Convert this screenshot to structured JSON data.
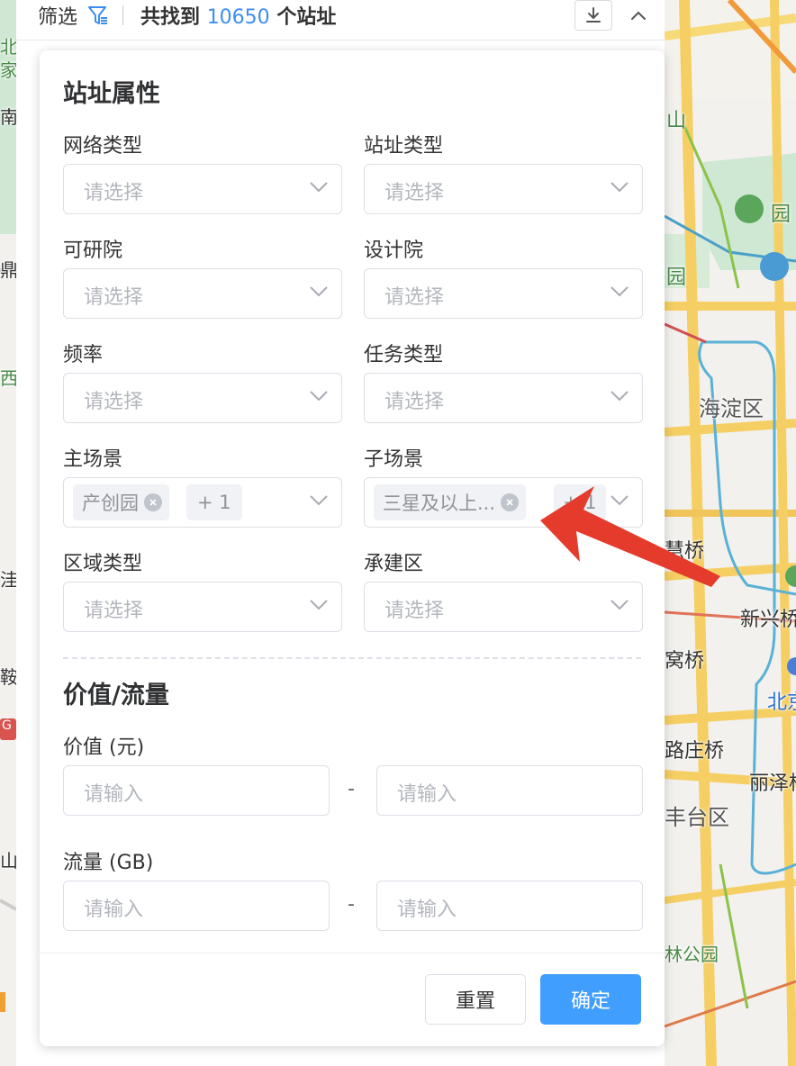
{
  "topbar": {
    "filter_label": "筛选",
    "result_prefix": "共找到",
    "result_count": "10650",
    "result_suffix": "个站址"
  },
  "site_attributes": {
    "title": "站址属性",
    "fields": {
      "network_type": {
        "label": "网络类型",
        "placeholder": "请选择"
      },
      "site_type": {
        "label": "站址类型",
        "placeholder": "请选择"
      },
      "research_institute": {
        "label": "可研院",
        "placeholder": "请选择"
      },
      "design_institute": {
        "label": "设计院",
        "placeholder": "请选择"
      },
      "frequency": {
        "label": "频率",
        "placeholder": "请选择"
      },
      "task_type": {
        "label": "任务类型",
        "placeholder": "请选择"
      },
      "main_scene": {
        "label": "主场景",
        "tag": "产创园",
        "more": "+ 1"
      },
      "sub_scene": {
        "label": "子场景",
        "tag": "三星及以上...",
        "more": "+ 1"
      },
      "area_type": {
        "label": "区域类型",
        "placeholder": "请选择"
      },
      "construction_area": {
        "label": "承建区",
        "placeholder": "请选择"
      }
    }
  },
  "value_traffic": {
    "title": "价值/流量",
    "value": {
      "label": "价值 (元)",
      "min_placeholder": "请输入",
      "max_placeholder": "请输入",
      "separator": "-"
    },
    "traffic": {
      "label": "流量 (GB)",
      "min_placeholder": "请输入",
      "max_placeholder": "请输入",
      "separator": "-"
    }
  },
  "footer": {
    "reset_label": "重置",
    "confirm_label": "确定"
  },
  "map": {
    "labels": {
      "haidian": "海淀区",
      "fengtai": "丰台区",
      "xinxingqiao": "新兴桥",
      "lizeqiao": "丽泽桥",
      "beijing": "北京",
      "huiqiao": "慧桥",
      "wuqiao": "窝桥",
      "luzhuangqiao": "路庄桥",
      "gongyuan": "林公园",
      "shan": "山",
      "yuan": "园",
      "yuan2": "园",
      "left_bei": "北",
      "left_jia": "家",
      "left_nan": "南",
      "left_ding": "鼎",
      "left_xi": "西",
      "left_wa": "洼",
      "left_an": "鞍",
      "left_shan": "山",
      "left_g": "G"
    }
  },
  "colors": {
    "accent": "#409eff",
    "count": "#3d8ef0",
    "arrow": "#e53b2c"
  }
}
